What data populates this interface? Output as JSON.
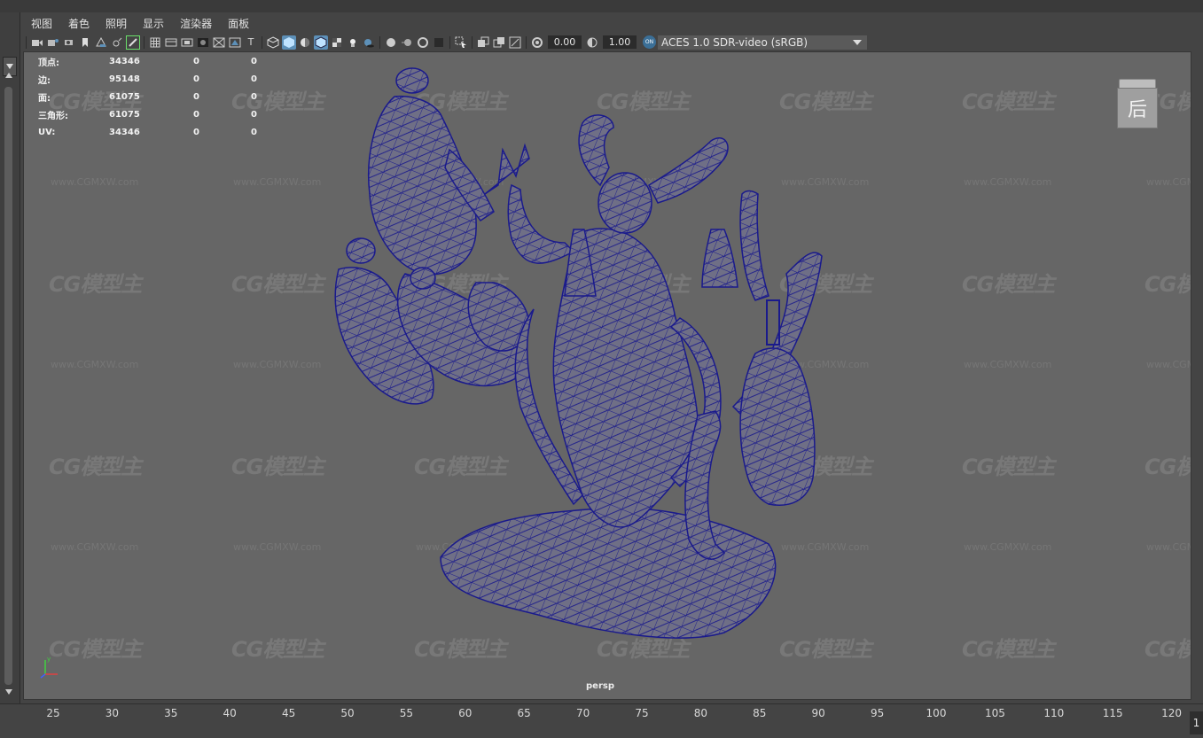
{
  "menubar": {
    "items": [
      "视图",
      "着色",
      "照明",
      "显示",
      "渲染器",
      "面板"
    ]
  },
  "toolbar": {
    "exposure_value": "0.00",
    "gamma_value": "1.00",
    "colorspace_badge": "ON",
    "colorspace_label": "ACES 1.0 SDR-video (sRGB)",
    "colors": {
      "active_icon": "#5d90b8",
      "highlight_border": "#6adf6a"
    },
    "icons": [
      "camera-icon",
      "camera-attributes-icon",
      "bookmark-icon",
      "image-plane-icon",
      "grease-pencil-icon",
      "grid-icon",
      "film-gate-icon",
      "resolution-gate-icon",
      "gate-mask-icon",
      "field-chart-icon",
      "safe-action-icon",
      "safe-title-icon",
      "wireframe-icon",
      "smooth-shade-icon",
      "wireframe-on-shaded-icon",
      "textured-icon",
      "use-all-lights-icon",
      "shadows-icon",
      "screen-space-ao-icon",
      "motion-blur-icon",
      "anti-aliasing-icon",
      "depth-of-field-icon",
      "isolate-select-icon",
      "xray-icon",
      "xray-active-components-icon",
      "xray-joints-icon",
      "exposure-icon",
      "gamma-icon"
    ]
  },
  "hud": {
    "rows": [
      {
        "label": "顶点:",
        "value": "34346",
        "sel": "0",
        "comp": "0"
      },
      {
        "label": "边:",
        "value": "95148",
        "sel": "0",
        "comp": "0"
      },
      {
        "label": "面:",
        "value": "61075",
        "sel": "0",
        "comp": "0"
      },
      {
        "label": "三角形:",
        "value": "61075",
        "sel": "0",
        "comp": "0"
      },
      {
        "label": "UV:",
        "value": "34346",
        "sel": "0",
        "comp": "0"
      }
    ]
  },
  "viewcube": {
    "face_label": "后"
  },
  "viewport": {
    "camera_label": "persp"
  },
  "watermark": {
    "logo": "CG模型主",
    "url": "www.CGMXW.com"
  },
  "timeline": {
    "ticks": [
      "25",
      "30",
      "35",
      "40",
      "45",
      "50",
      "55",
      "60",
      "65",
      "70",
      "75",
      "80",
      "85",
      "90",
      "95",
      "100",
      "105",
      "110",
      "115",
      "120"
    ],
    "current_frame": "1"
  },
  "colors": {
    "mesh_wire": "#1a1a8c",
    "mesh_fill": "#6f6f86",
    "viewport_bg": "#666666"
  }
}
